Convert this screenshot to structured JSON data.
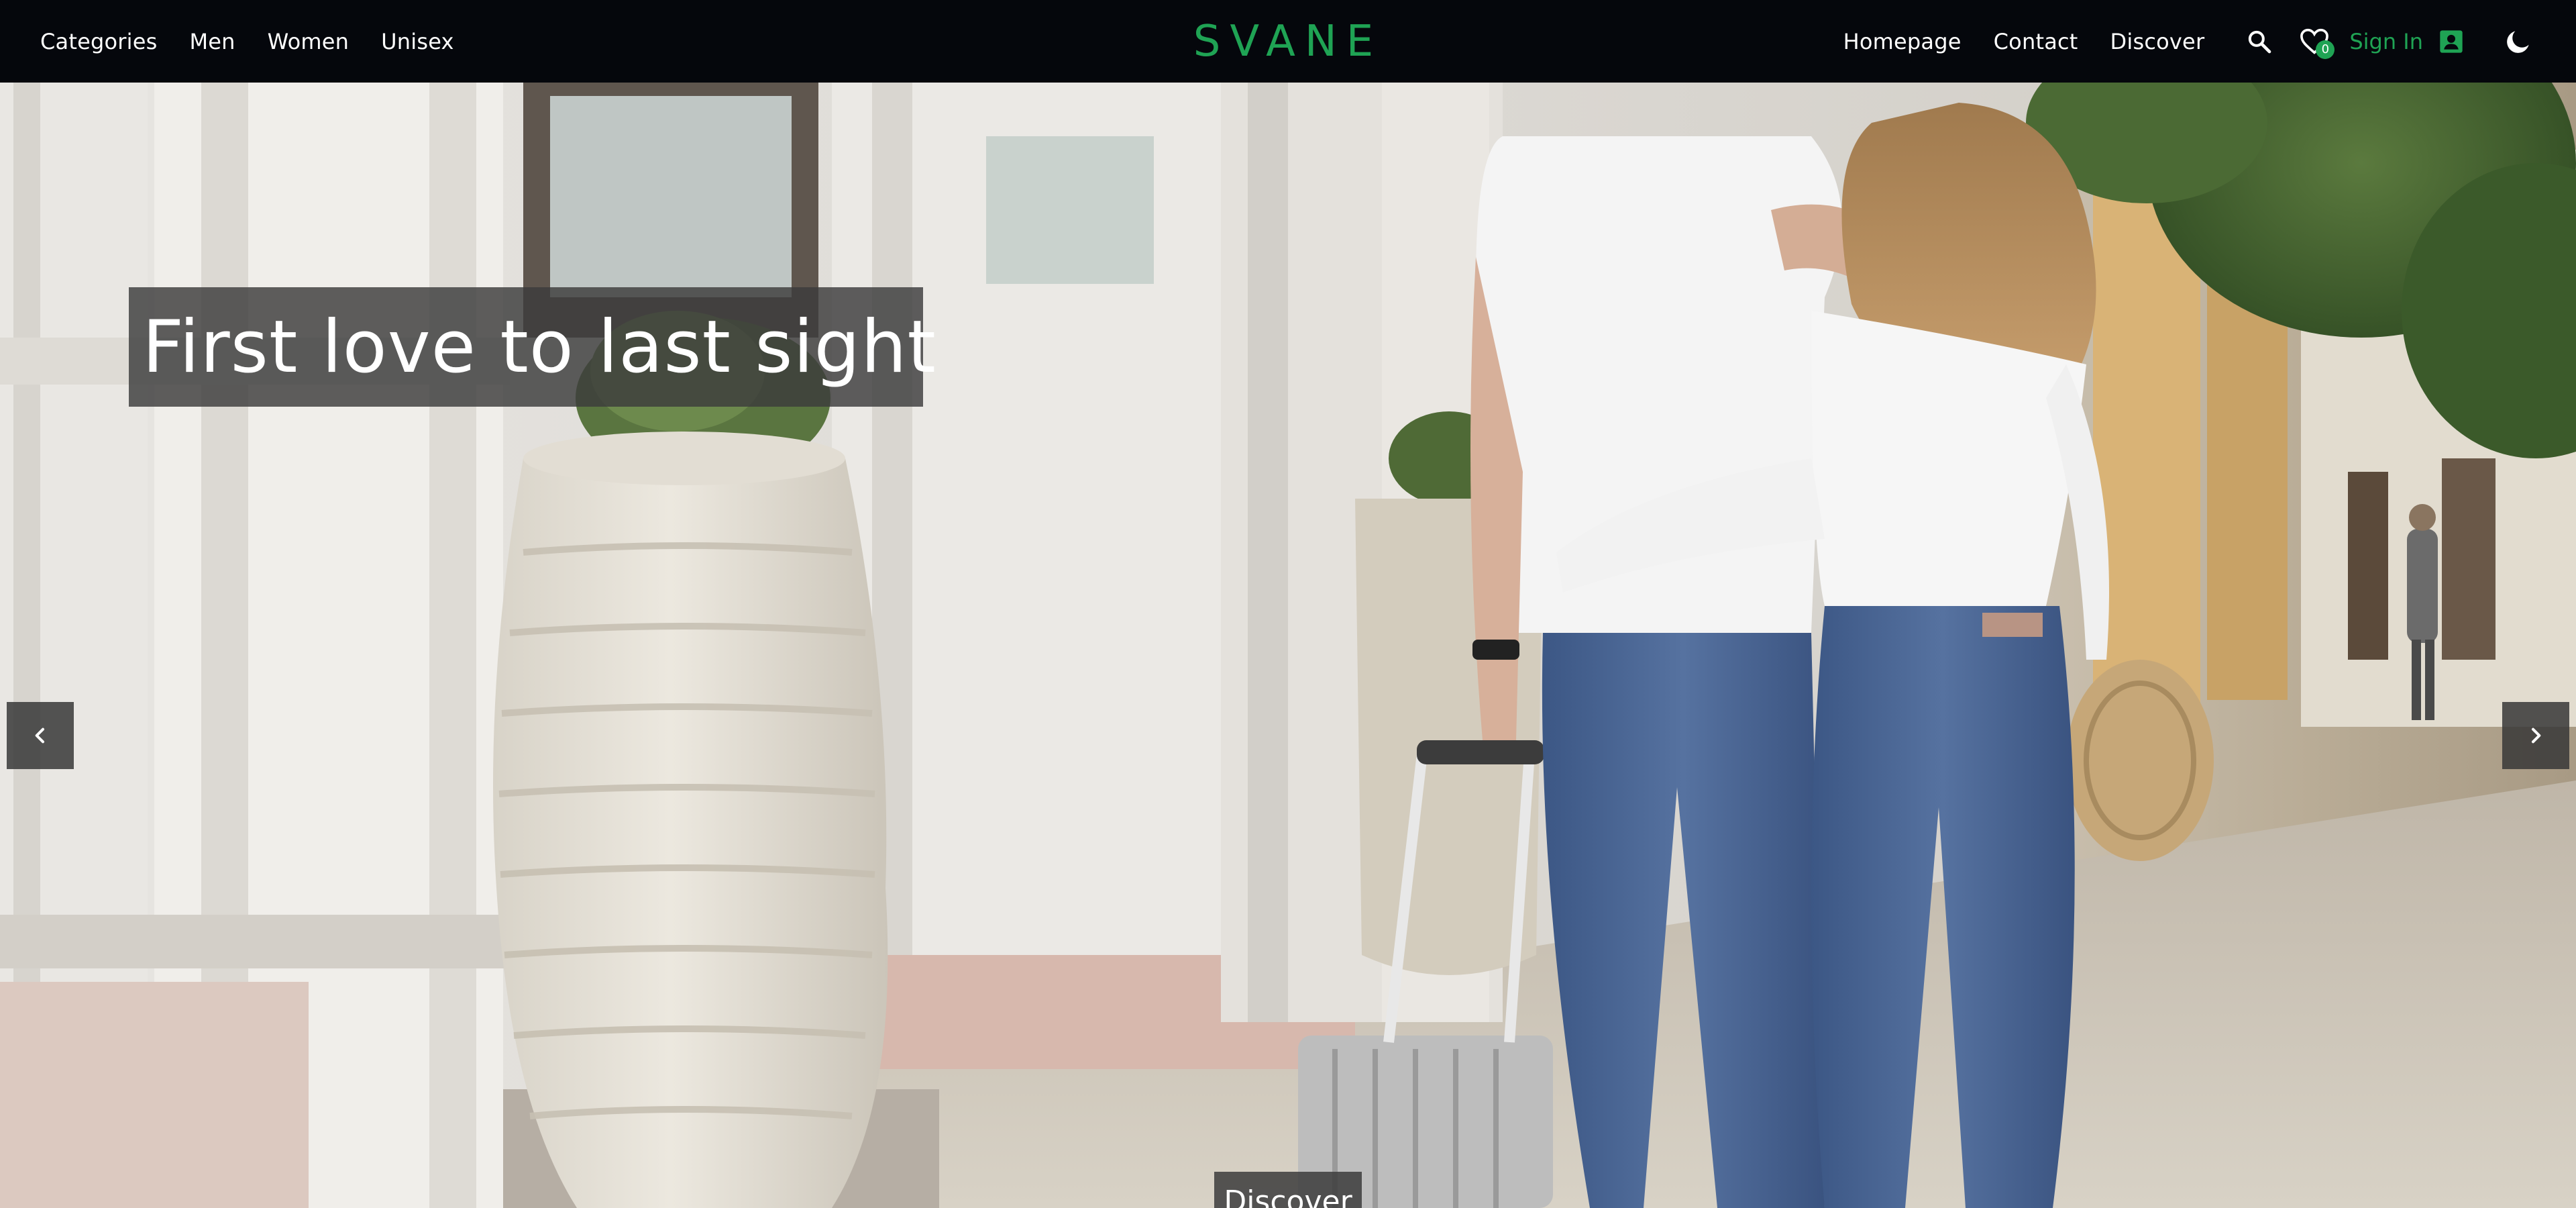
{
  "navbar": {
    "left_links": [
      "Categories",
      "Men",
      "Women",
      "Unisex"
    ],
    "brand": "SVANE",
    "right_links": [
      "Homepage",
      "Contact",
      "Discover"
    ],
    "icons": {
      "search": "search-icon",
      "wishlist": "heart-icon",
      "account": "account-box-icon",
      "theme": "moon-icon"
    },
    "wishlist_count": "0",
    "signin_label": "Sign In"
  },
  "hero": {
    "title": "First love to last sight",
    "discover_label": "Discover",
    "icons": {
      "prev": "chevron-left-icon",
      "next": "chevron-right-icon",
      "discover_arrow": "chevron-down-icon"
    }
  },
  "colors": {
    "navbar_bg": "#05070c",
    "brand_green": "#1fa354",
    "overlay_box": "#3c3c3c"
  }
}
